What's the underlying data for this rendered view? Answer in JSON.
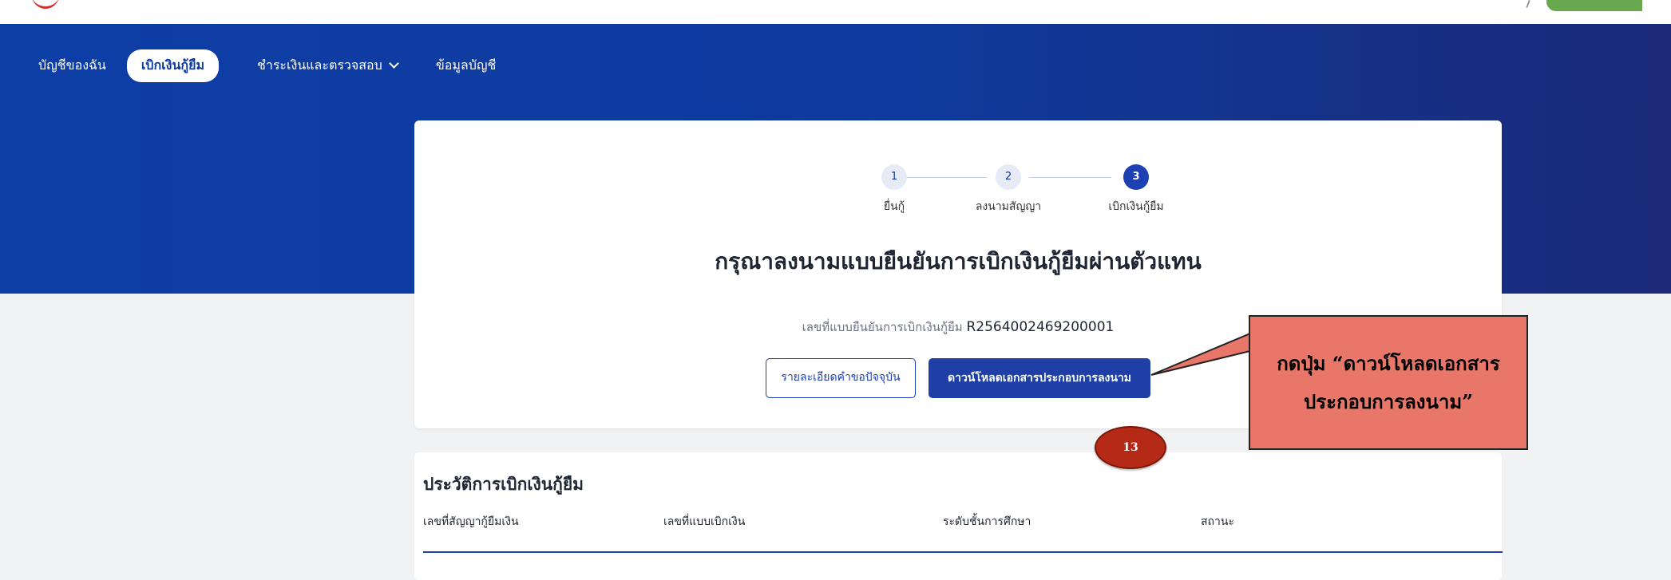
{
  "nav": {
    "items": [
      {
        "label": "บัญชีของฉัน"
      },
      {
        "label": "เบิกเงินกู้ยืม"
      },
      {
        "label": "ชำระเงินและตรวจสอบ"
      },
      {
        "label": "ข้อมูลบัญชี"
      }
    ]
  },
  "stepper": {
    "steps": [
      {
        "number": "1",
        "label": "ยื่นกู้"
      },
      {
        "number": "2",
        "label": "ลงนามสัญญา"
      },
      {
        "number": "3",
        "label": "เบิกเงินกู้ยืม"
      }
    ],
    "current": 3
  },
  "main": {
    "title": "กรุณาลงนามแบบยืนยันการเบิกเงินกู้ยืมผ่านตัวแทน",
    "ref_label": "เลขที่แบบยืนยันการเบิกเงินกู้ยืม",
    "ref_value": "R2564002469200001",
    "btn_details": "รายละเอียดคำขอปัจจุบัน",
    "btn_download": "ดาวน์โหลดเอกสารประกอบการลงนาม"
  },
  "history": {
    "title": "ประวัติการเบิกเงินกู้ยืม",
    "columns": [
      "เลขที่สัญญากู้ยืมเงิน",
      "เลขที่แบบเบิกเงิน",
      "ระดับชั้นการศึกษา",
      "สถานะ"
    ]
  },
  "annotation": {
    "line1": "กดปุ่ม “ดาวน์โหลดเอกสาร",
    "line2": "ประกอบการลงนาม”",
    "badge": "13"
  },
  "colors": {
    "primary": "#1d40b2",
    "hero": "#0f3a9d",
    "callout": "#e8776a",
    "badge": "#b52a16"
  }
}
